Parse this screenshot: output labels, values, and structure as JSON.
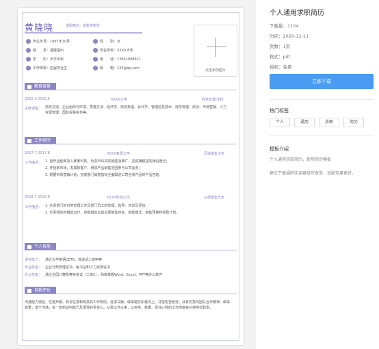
{
  "resume": {
    "name": "黄晓晓",
    "intent": "求职意向：销售类岗位",
    "photo_caption": "点击添加图片",
    "info": [
      {
        "label": "出生年月：1997年10月",
        "icon": "calendar-icon"
      },
      {
        "label": "性　　别：女",
        "icon": "person-icon"
      },
      {
        "label": "籍　　贯：福建福州",
        "icon": "home-icon"
      },
      {
        "label": "毕业学校：XXXX大学",
        "icon": "school-icon"
      },
      {
        "label": "学　　历：大学本科",
        "icon": "degree-icon"
      },
      {
        "label": "电　　话：13801008611",
        "icon": "phone-icon"
      },
      {
        "label": "工作年限：应届毕业生",
        "icon": "briefcase-icon"
      },
      {
        "label": "邮　　箱：123@qq.com",
        "icon": "mail-icon"
      }
    ],
    "education": {
      "title": "教育背景",
      "date": "2015.9-2019.6",
      "school": "XXXX大学",
      "major": "商务管理/本科",
      "courses_label": "主修课程：",
      "courses": "商务交流、企业组织与环境、质量方法、经济学、商务英语、会计学、管理信息技术、财务管理、商法、市场营销、人力资源管理、国际贸易实务等。"
    },
    "work": {
      "title": "工作经历",
      "jobs": [
        {
          "date": "2017.7-2017.8",
          "company": "XXXX有限公司",
          "role": "区域销售主管",
          "desc_label": "工作描述：",
          "lines": [
            "1. 自毕业起即加入某某科技，负责POS机的销售及推广，完成旗舰店的铺设登记；",
            "2. 开拓新市场，发展新客户，增加产品销售范围参与公司会务；",
            "3. 根据市场营销计划，完成部门销售指标全面跟进公司全线产品的产品性能。"
          ]
        },
        {
          "date": "2018.7-2018.8",
          "company": "XXXX科技公司",
          "role": "从部销售代表",
          "desc_label": "工作描述：",
          "lines": [
            "1. 负责部门的日常管理工作及部门员工的管理、指导、培训及评估；",
            "2. 负责组织的销售运作，协助销售总监设置销售目标、销售模式、销售预算和奖励计划。"
          ]
        }
      ]
    },
    "skills": {
      "title": "个人技能",
      "items": [
        {
          "label": "语言能力：",
          "text": "通过大学英语CET6，普通话二级甲等"
        },
        {
          "label": "专业技能：",
          "text": "企业行政管理证书、秘书证和人力资源证书"
        },
        {
          "label": "办公技能：",
          "text": "通过全国计算机等级考试（二级C），熟练掌握Word、Excel、PPT等办公软件"
        }
      ]
    },
    "self_eval": {
      "title": "自我评价",
      "text": "沟通能力很强，性格开朗。有责任感和较高的工作热情，处事冷静，做事踏实积极向上。并能吃苦耐劳，具有优秀的团队合作精神。做事稳重，善于沟通，有一定的谈判能力及很强的责任心。从事工作以来，以务实、稳重、责任心强的工作态度来对待岗位职责。"
    }
  },
  "panel": {
    "title": "个人通用求职简历",
    "meta": [
      "下载量：1104",
      "时间：2020-12-11",
      "页数：1页",
      "格式：pdf",
      "授权：免费"
    ],
    "download_label": "立即下载",
    "tags_title": "热门标签",
    "tags": [
      "个人",
      "通用",
      "求职",
      "简历"
    ],
    "intro_title": "模板介绍",
    "intro_1": "个人通用求职简历，使用简历模板",
    "intro_2": "建议下载福昕阅读器填写表单，适配效果更好。"
  },
  "colors": {
    "accent": "#8c87c3",
    "button": "#4a9bf2",
    "left_bg": "#f3f3f4"
  }
}
